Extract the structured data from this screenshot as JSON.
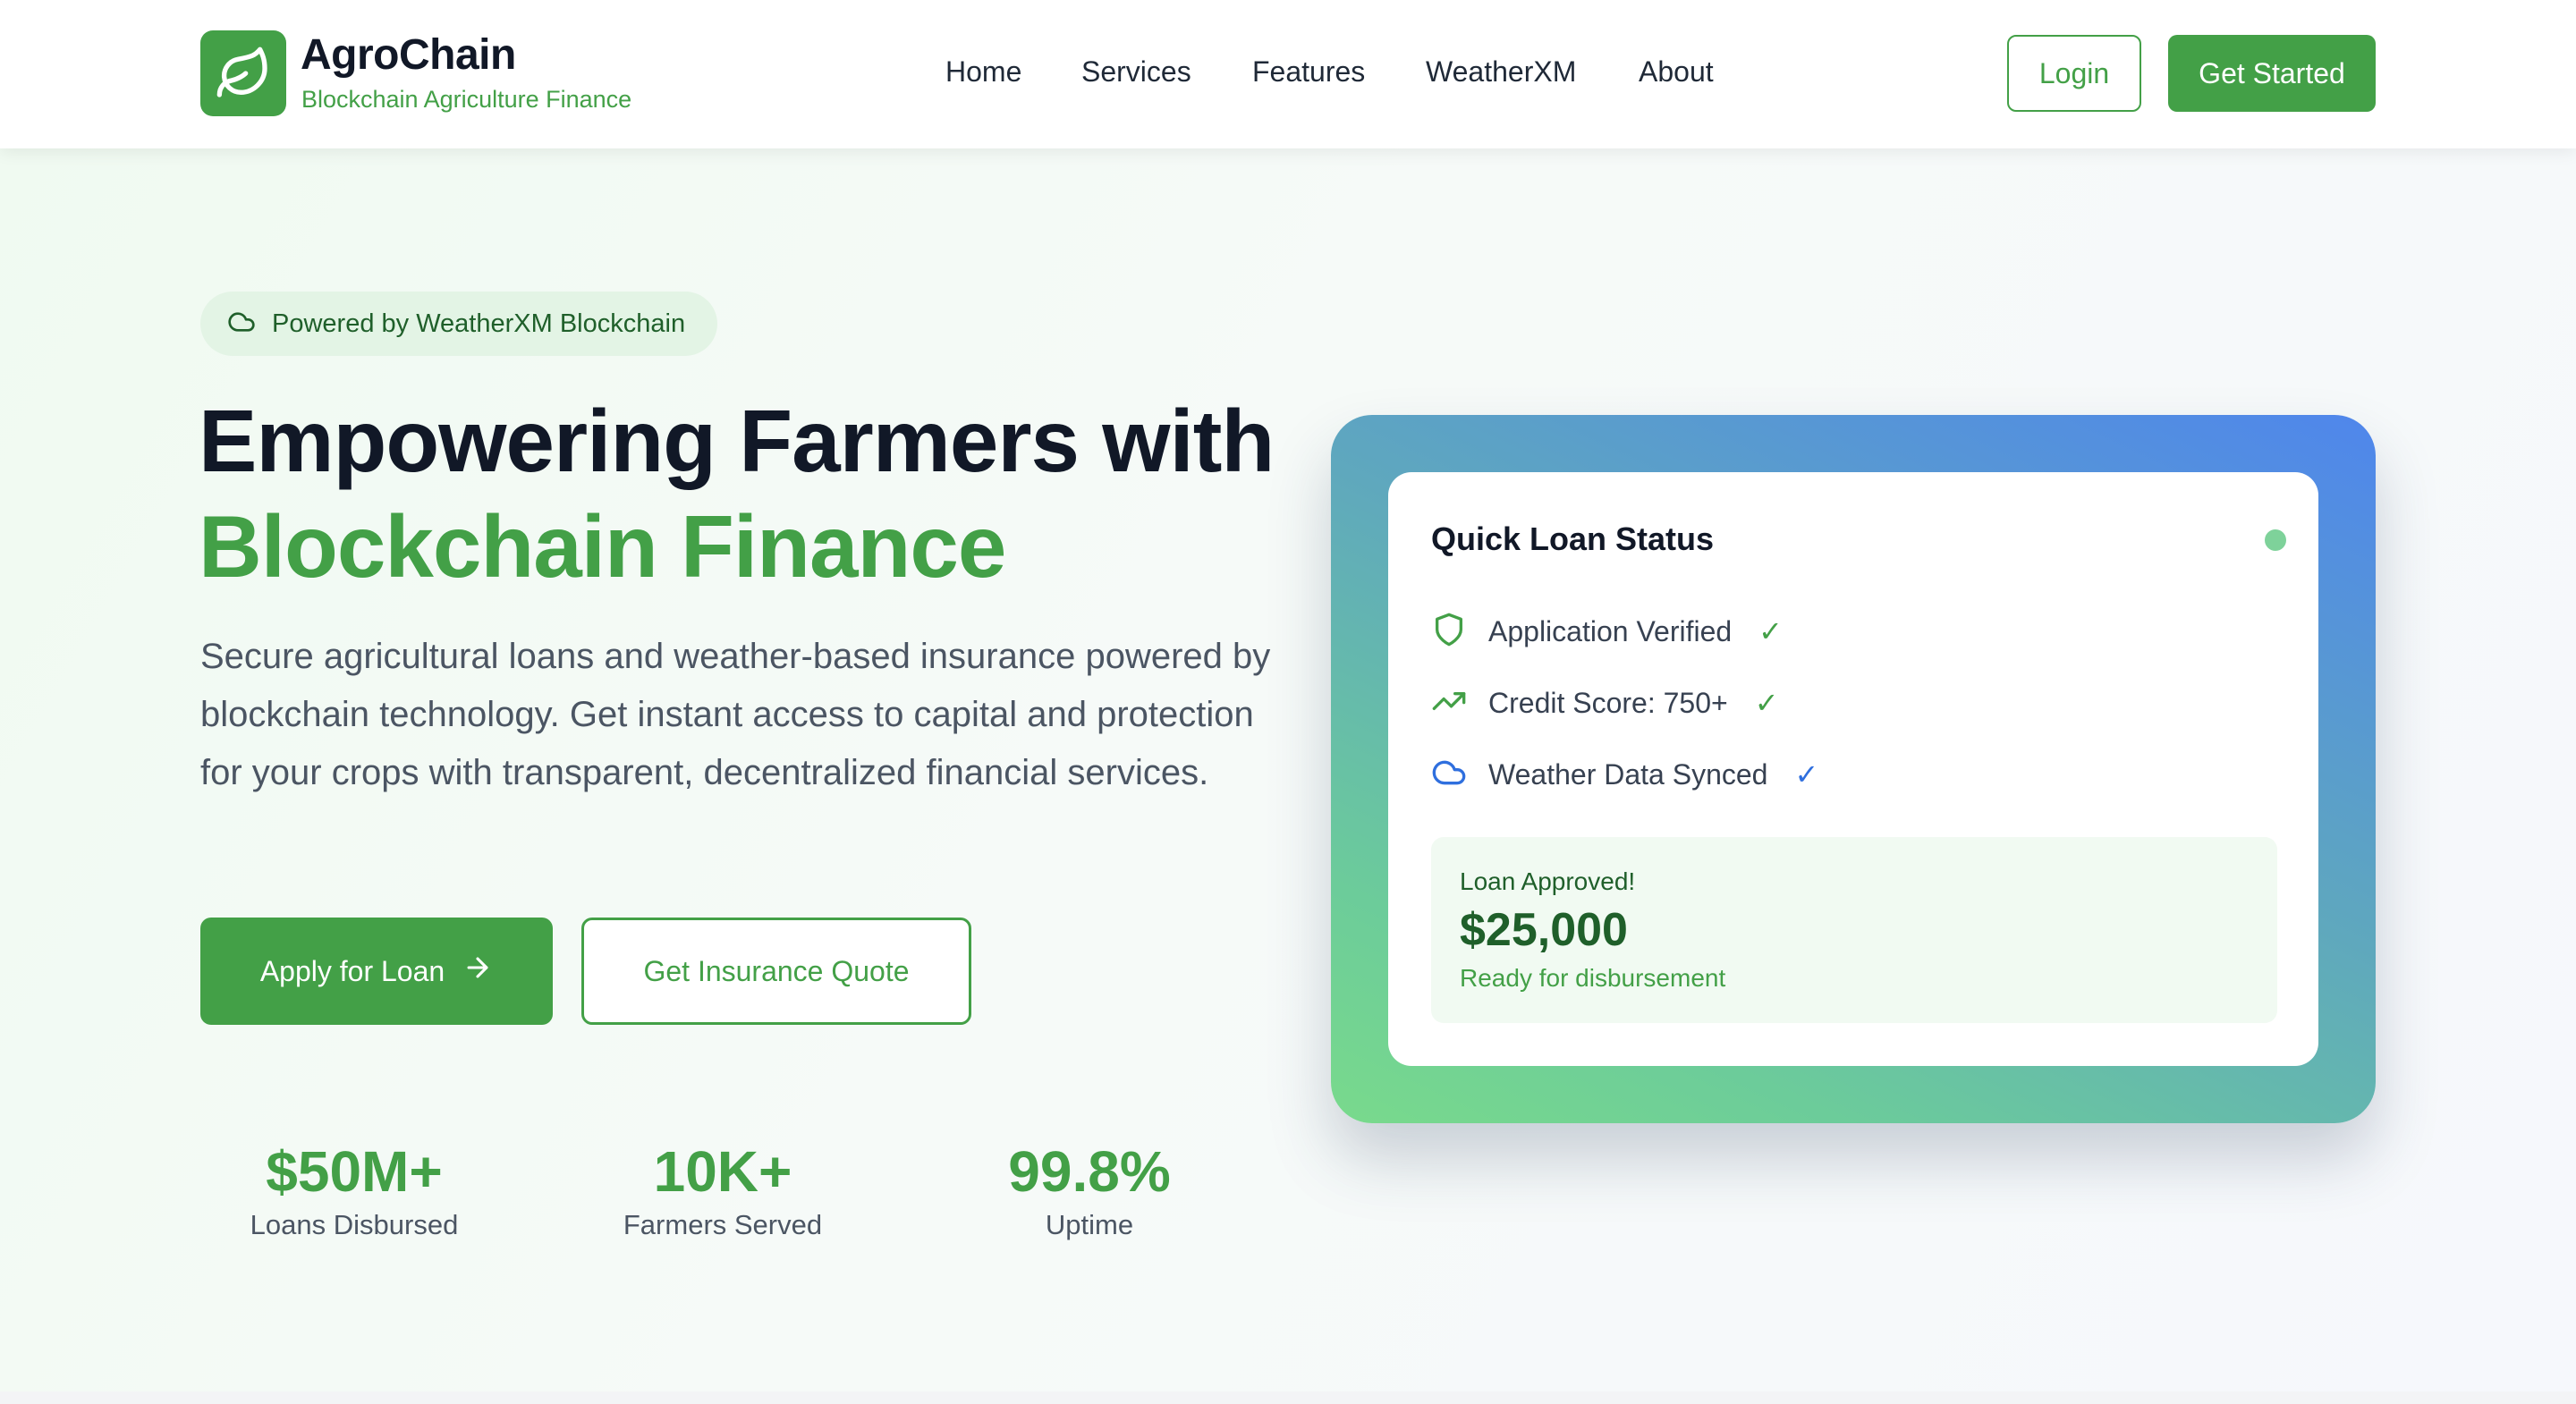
{
  "brand": {
    "name": "AgroChain",
    "tagline": "Blockchain Agriculture Finance",
    "logo_icon": "leaf-icon",
    "accent_color": "#43a047"
  },
  "nav": {
    "items": [
      {
        "label": "Home"
      },
      {
        "label": "Services"
      },
      {
        "label": "Features"
      },
      {
        "label": "WeatherXM"
      },
      {
        "label": "About"
      }
    ]
  },
  "header_actions": {
    "login_label": "Login",
    "get_started_label": "Get Started"
  },
  "hero": {
    "badge_icon": "cloud-icon",
    "badge_text": "Powered by WeatherXM Blockchain",
    "headline_line1": "Empowering Farmers with",
    "headline_line2": "Blockchain Finance",
    "lead": "Secure agricultural loans and weather-based insurance powered by blockchain technology. Get instant access to capital and protection for your crops with transparent, decentralized financial services.",
    "apply_label": "Apply for Loan",
    "apply_icon": "arrow-right-icon",
    "quote_label": "Get Insurance Quote",
    "stats": [
      {
        "value": "$50M+",
        "label": "Loans Disbursed"
      },
      {
        "value": "10K+",
        "label": "Farmers Served"
      },
      {
        "value": "99.8%",
        "label": "Uptime"
      }
    ]
  },
  "loan_card": {
    "title": "Quick Loan Status",
    "status_color": "#7ed29a",
    "checks": [
      {
        "icon": "shield-icon",
        "label": "Application Verified",
        "mark": "✓",
        "color": "#43a047"
      },
      {
        "icon": "trending-up-icon",
        "label": "Credit Score: 750+",
        "mark": "✓",
        "color": "#43a047"
      },
      {
        "icon": "cloud-icon",
        "label": "Weather Data Synced",
        "mark": "✓",
        "color": "#2f6fde"
      }
    ],
    "approved_label": "Loan Approved!",
    "approved_amount": "$25,000",
    "approved_sub": "Ready for disbursement"
  }
}
